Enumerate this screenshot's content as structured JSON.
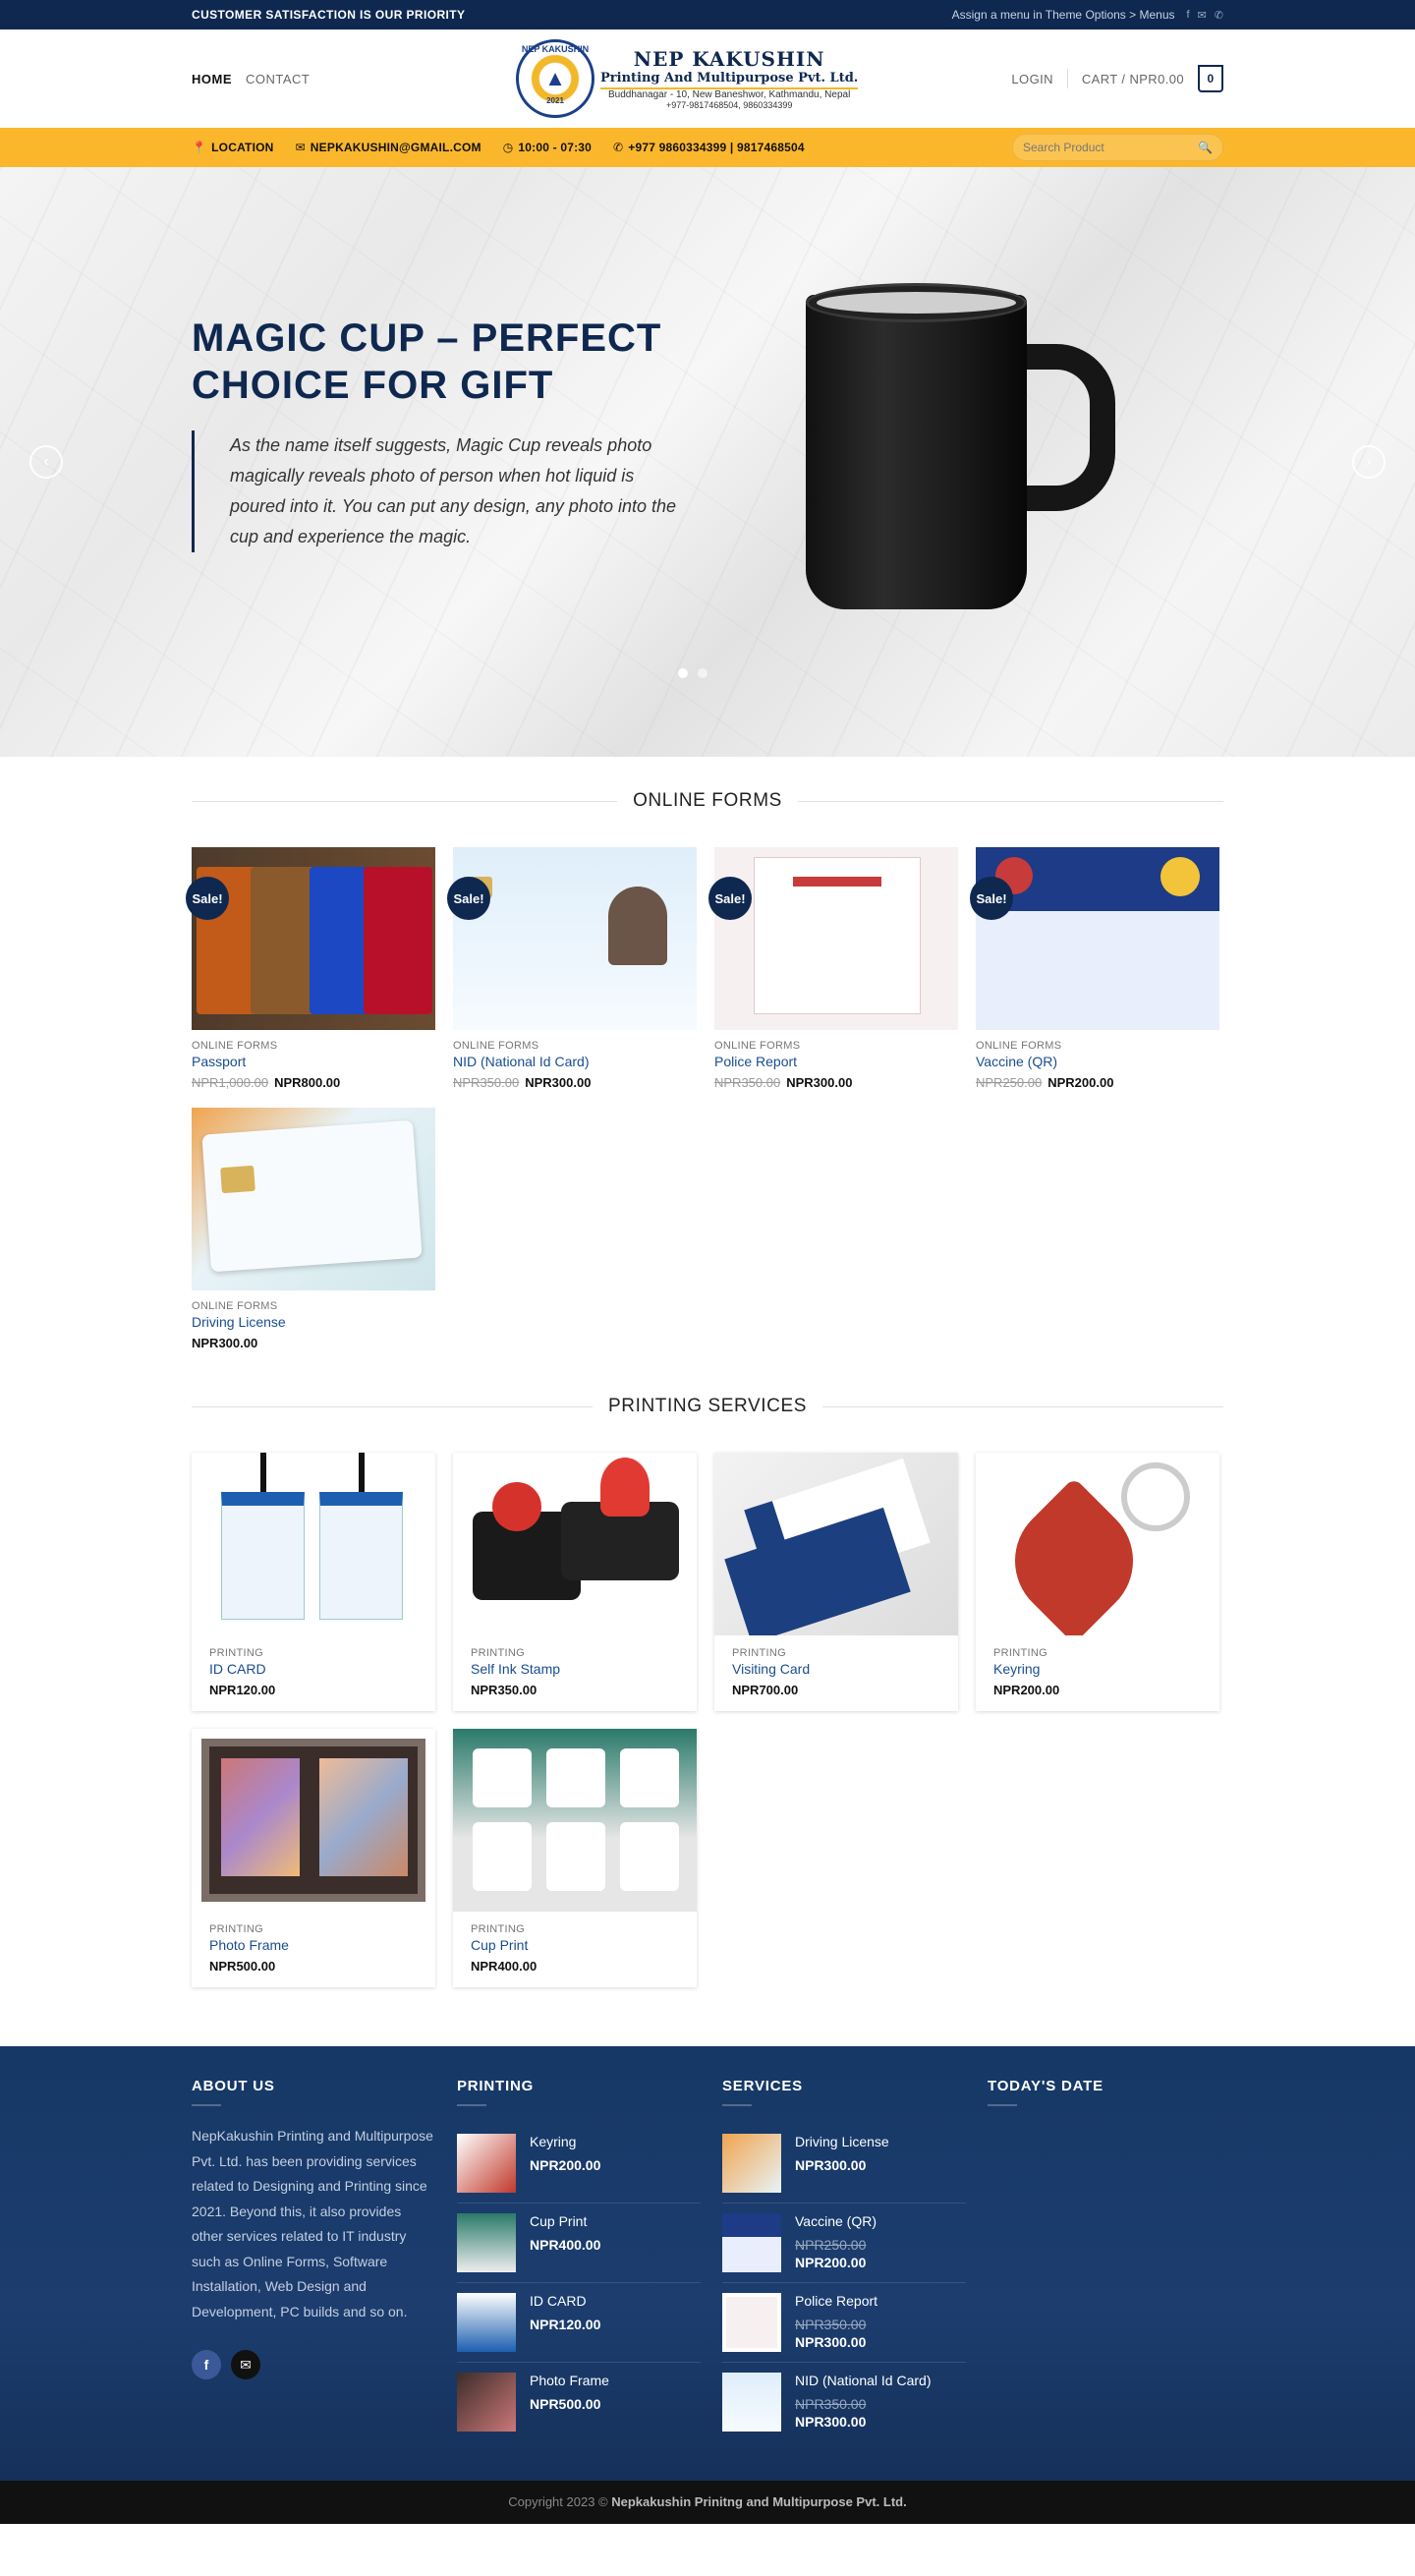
{
  "topbar": {
    "tagline": "CUSTOMER SATISFACTION IS OUR PRIORITY",
    "menu_hint": "Assign a menu in Theme Options > Menus",
    "socials": [
      "facebook-icon",
      "email-icon",
      "phone-icon"
    ]
  },
  "header": {
    "nav": [
      {
        "label": "HOME"
      },
      {
        "label": "CONTACT"
      }
    ],
    "logo": {
      "badge_ring": "NEP KAKUSHIN",
      "badge_year": "2021",
      "name": "NEP KAKUSHIN",
      "subtitle": "Printing And Multipurpose Pvt. Ltd.",
      "address": "Buddhanagar - 10, New Baneshwor, Kathmandu, Nepal",
      "phones": "+977-9817468504, 9860334399"
    },
    "login": "LOGIN",
    "cart_label": "CART / NPR0.00",
    "cart_count": "0"
  },
  "infobar": {
    "location": "LOCATION",
    "email": "NEPKAKUSHIN@GMAIL.COM",
    "hours": "10:00 - 07:30",
    "phone": "+977 9860334399 | 9817468504",
    "search_placeholder": "Search Product"
  },
  "hero": {
    "title": "MAGIC CUP – PERFECT CHOICE FOR GIFT",
    "quote": "As the name itself suggests, Magic Cup reveals photo magically reveals photo of person when hot liquid is poured into it. You can put any design, any photo into the cup and experience the magic."
  },
  "online_forms": {
    "title": "ONLINE FORMS",
    "products": [
      {
        "category": "ONLINE FORMS",
        "name": "Passport",
        "old_price": "NPR1,000.00",
        "price": "NPR800.00",
        "sale": "Sale!"
      },
      {
        "category": "ONLINE FORMS",
        "name": "NID (National Id Card)",
        "old_price": "NPR350.00",
        "price": "NPR300.00",
        "sale": "Sale!"
      },
      {
        "category": "ONLINE FORMS",
        "name": "Police Report",
        "old_price": "NPR350.00",
        "price": "NPR300.00",
        "sale": "Sale!"
      },
      {
        "category": "ONLINE FORMS",
        "name": "Vaccine (QR)",
        "old_price": "NPR250.00",
        "price": "NPR200.00",
        "sale": "Sale!"
      },
      {
        "category": "ONLINE FORMS",
        "name": "Driving License",
        "price": "NPR300.00"
      }
    ]
  },
  "printing": {
    "title": "PRINTING SERVICES",
    "products": [
      {
        "category": "PRINTING",
        "name": "ID CARD",
        "price": "NPR120.00"
      },
      {
        "category": "PRINTING",
        "name": "Self Ink Stamp",
        "price": "NPR350.00"
      },
      {
        "category": "PRINTING",
        "name": "Visiting Card",
        "price": "NPR700.00"
      },
      {
        "category": "PRINTING",
        "name": "Keyring",
        "price": "NPR200.00"
      },
      {
        "category": "PRINTING",
        "name": "Photo Frame",
        "price": "NPR500.00"
      },
      {
        "category": "PRINTING",
        "name": "Cup Print",
        "price": "NPR400.00"
      }
    ]
  },
  "footer": {
    "about_title": "ABOUT US",
    "about_text": "NepKakushin Printing and Multipurpose Pvt. Ltd. has been providing services related to Designing and Printing since 2021. Beyond this, it also provides other services related to IT industry such as Online Forms, Software Installation, Web Design and Development, PC builds and so on.",
    "printing_title": "PRINTING",
    "printing_items": [
      {
        "name": "Keyring",
        "price": "NPR200.00"
      },
      {
        "name": "Cup Print",
        "price": "NPR400.00"
      },
      {
        "name": "ID CARD",
        "price": "NPR120.00"
      },
      {
        "name": "Photo Frame",
        "price": "NPR500.00"
      }
    ],
    "services_title": "SERVICES",
    "services_items": [
      {
        "name": "Driving License",
        "price": "NPR300.00"
      },
      {
        "name": "Vaccine (QR)",
        "old_price": "NPR250.00",
        "price": "NPR200.00"
      },
      {
        "name": "Police Report",
        "old_price": "NPR350.00",
        "price": "NPR300.00"
      },
      {
        "name": "NID (National Id Card)",
        "old_price": "NPR350.00",
        "price": "NPR300.00"
      }
    ],
    "date_title": "TODAY'S DATE",
    "copyright_prefix": "Copyright 2023 ©",
    "copyright_name": "Nepkakushin Prinitng and Multipurpose Pvt. Ltd."
  },
  "colors": {
    "navy": "#0f2850",
    "yellow": "#fbb72b",
    "link": "#1a4d8f"
  }
}
